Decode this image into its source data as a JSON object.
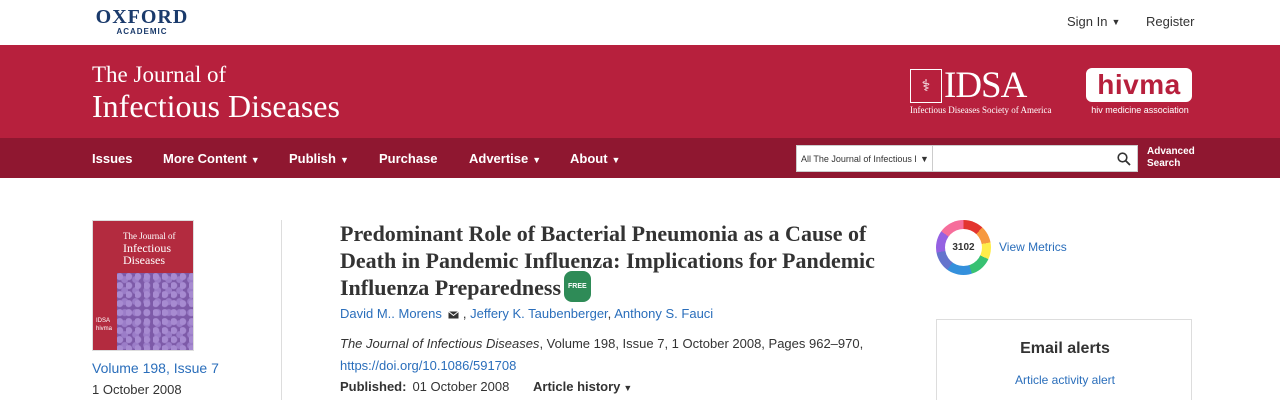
{
  "header": {
    "brand": "OXFORD",
    "brand_sub": "ACADEMIC",
    "signin_label": "Sign In",
    "register_label": "Register"
  },
  "journal": {
    "title_line1": "The Journal of",
    "title_line2": "Infectious Diseases",
    "idsa_word": "IDSA",
    "idsa_sub": "Infectious Diseases Society of America",
    "hivma_word": "hivma",
    "hivma_sub": "hiv medicine association"
  },
  "nav": {
    "items": [
      {
        "label": "Issues",
        "dropdown": false
      },
      {
        "label": "More Content",
        "dropdown": true
      },
      {
        "label": "Publish",
        "dropdown": true
      },
      {
        "label": "Purchase",
        "dropdown": false
      },
      {
        "label": "Advertise",
        "dropdown": true
      },
      {
        "label": "About",
        "dropdown": true
      }
    ],
    "search_scope": "All The Journal of Infectious Diseases",
    "search_placeholder": "",
    "advanced_line1": "Advanced",
    "advanced_line2": "Search"
  },
  "issue": {
    "cover_title_line1": "The Journal of",
    "cover_title_line2": "Infectious",
    "cover_title_line3": "Diseases",
    "volume_label": "Volume 198, Issue 7",
    "date": "1 October 2008"
  },
  "article": {
    "title": "Predominant Role of Bacterial Pneumonia as a Cause of Death in Pandemic Influenza: Implications for Pandemic Influenza Preparedness",
    "badge": "FREE",
    "authors": [
      "David M.. Morens",
      "Jeffery K. Taubenberger",
      "Anthony S. Fauci"
    ],
    "journal_name": "The Journal of Infectious Diseases",
    "citation_rest": ", Volume 198, Issue 7, 1 October 2008, Pages 962–970,",
    "doi": "https://doi.org/10.1086/591708",
    "published_label": "Published:",
    "published_date": "01 October 2008",
    "history_label": "Article history"
  },
  "sidebar": {
    "altmetric_score": "3102",
    "metrics_label": "View Metrics",
    "alerts_title": "Email alerts",
    "alert_link": "Article activity alert"
  },
  "colors": {
    "banner": "#b7203d",
    "nav": "#8f1730",
    "link": "#2a6ebb",
    "badge": "#2e8b57"
  }
}
